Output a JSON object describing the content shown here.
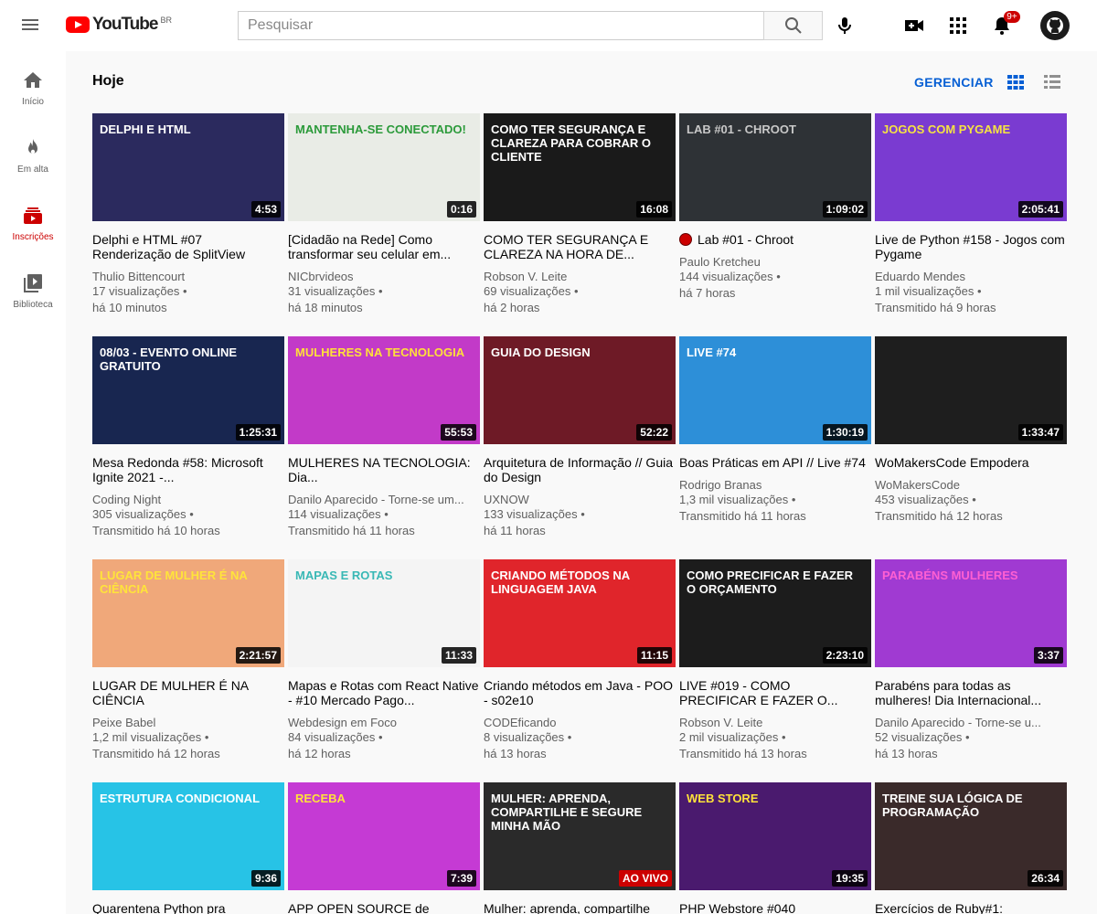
{
  "header": {
    "logo_text": "YouTube",
    "country": "BR",
    "search_placeholder": "Pesquisar",
    "notifications_badge": "9+"
  },
  "sidebar": {
    "items": [
      {
        "label": "Início",
        "icon": "home-icon"
      },
      {
        "label": "Em alta",
        "icon": "fire-icon"
      },
      {
        "label": "Inscrições",
        "icon": "subscriptions-icon",
        "active": true
      },
      {
        "label": "Biblioteca",
        "icon": "library-icon"
      }
    ]
  },
  "section": {
    "title": "Hoje",
    "manage_label": "GERENCIAR"
  },
  "videos": [
    {
      "title": "Delphi e HTML #07 Renderização de SplitView",
      "channel": "Thulio Bittencourt",
      "views": "17 visualizações",
      "time": "há 10 minutos",
      "duration": "4:53",
      "thumb_text": "Delphi e HTML",
      "thumb_bg": "#2b2a5e",
      "thumb_fg": "#ffffff"
    },
    {
      "title": "[Cidadão na Rede] Como transformar seu celular em...",
      "channel": "NICbrvideos",
      "views": "31 visualizações",
      "time": "há 18 minutos",
      "duration": "0:16",
      "thumb_text": "Mantenha-se conectado!",
      "thumb_bg": "#e9ece6",
      "thumb_fg": "#2b9a3a"
    },
    {
      "title": "COMO TER SEGURANÇA E CLAREZA NA HORA DE...",
      "channel": "Robson V. Leite",
      "views": "69 visualizações",
      "time": "há 2 horas",
      "duration": "16:08",
      "thumb_text": "Como ter segurança e clareza para cobrar o cliente",
      "thumb_bg": "#1a1a1a",
      "thumb_fg": "#ffffff"
    },
    {
      "title": "Lab #01 - Chroot",
      "channel": "Paulo Kretcheu",
      "views": "144 visualizações",
      "time": "há 7 horas",
      "duration": "1:09:02",
      "live_dot": true,
      "thumb_text": "Lab #01 - chroot",
      "thumb_bg": "#2e3236",
      "thumb_fg": "#c8c8c8"
    },
    {
      "title": "Live de Python #158 - Jogos com Pygame",
      "channel": "Eduardo Mendes",
      "views": "1 mil visualizações",
      "time": "Transmitido há 9 horas",
      "duration": "2:05:41",
      "thumb_text": "Jogos com Pygame",
      "thumb_bg": "#7a3bd1",
      "thumb_fg": "#f5e342"
    },
    {
      "title": "Mesa Redonda #58: Microsoft Ignite 2021 -...",
      "channel": "Coding Night",
      "views": "305 visualizações",
      "time": "Transmitido há 10 horas",
      "duration": "1:25:31",
      "thumb_text": "08/03 - Evento online gratuito",
      "thumb_bg": "#182650",
      "thumb_fg": "#ffffff"
    },
    {
      "title": "MULHERES NA TECNOLOGIA: Dia...",
      "channel": "Danilo Aparecido - Torne-se um...",
      "views": "114 visualizações",
      "time": "Transmitido há 11 horas",
      "duration": "55:53",
      "thumb_text": "Mulheres na tecnologia",
      "thumb_bg": "#c23ac8",
      "thumb_fg": "#ffe03a"
    },
    {
      "title": "Arquitetura de Informação // Guia do Design",
      "channel": "UXNOW",
      "views": "133 visualizações",
      "time": "há 11 horas",
      "duration": "52:22",
      "thumb_text": "Guia do Design",
      "thumb_bg": "#6e1a26",
      "thumb_fg": "#ffffff"
    },
    {
      "title": "Boas Práticas em API // Live #74",
      "channel": "Rodrigo Branas",
      "views": "1,3 mil visualizações",
      "time": "Transmitido há 11 horas",
      "duration": "1:30:19",
      "thumb_text": "Live #74",
      "thumb_bg": "#2d8fd8",
      "thumb_fg": "#ffffff"
    },
    {
      "title": "WoMakersCode Empodera",
      "channel": "WoMakersCode",
      "views": "453 visualizações",
      "time": "Transmitido há 12 horas",
      "duration": "1:33:47",
      "thumb_text": "",
      "thumb_bg": "#1e1e1e",
      "thumb_fg": "#ffffff"
    },
    {
      "title": "LUGAR DE MULHER É NA CIÊNCIA",
      "channel": "Peixe Babel",
      "views": "1,2 mil visualizações",
      "time": "Transmitido há 12 horas",
      "duration": "2:21:57",
      "thumb_text": "Lugar de mulher é na ciência",
      "thumb_bg": "#f0a87a",
      "thumb_fg": "#ffe43a"
    },
    {
      "title": "Mapas e Rotas com React Native - #10 Mercado Pago...",
      "channel": "Webdesign em Foco",
      "views": "84 visualizações",
      "time": "há 12 horas",
      "duration": "11:33",
      "thumb_text": "Mapas e Rotas",
      "thumb_bg": "#f4f4f4",
      "thumb_fg": "#39b8b5"
    },
    {
      "title": "Criando métodos em Java - POO - s02e10",
      "channel": "CODEficando",
      "views": "8 visualizações",
      "time": "há 13 horas",
      "duration": "11:15",
      "thumb_text": "Criando métodos na linguagem Java",
      "thumb_bg": "#e0252b",
      "thumb_fg": "#ffffff"
    },
    {
      "title": "LIVE #019 - COMO PRECIFICAR E FAZER O...",
      "channel": "Robson V. Leite",
      "views": "2 mil visualizações",
      "time": "Transmitido há 13 horas",
      "duration": "2:23:10",
      "thumb_text": "Como precificar e fazer o orçamento",
      "thumb_bg": "#1c1c1c",
      "thumb_fg": "#ffffff"
    },
    {
      "title": "Parabéns para todas as mulheres! Dia Internacional...",
      "channel": "Danilo Aparecido - Torne-se u...",
      "views": "52 visualizações",
      "time": "há 13 horas",
      "duration": "3:37",
      "thumb_text": "Parabéns Mulheres",
      "thumb_bg": "#a03ad2",
      "thumb_fg": "#ff5fd3"
    },
    {
      "title": "Quarentena Python pra",
      "channel": "",
      "views": "",
      "time": "",
      "duration": "9:36",
      "thumb_text": "Estrutura condicional",
      "thumb_bg": "#27c3e6",
      "thumb_fg": "#ffffff"
    },
    {
      "title": "APP OPEN SOURCE de",
      "channel": "",
      "views": "",
      "time": "",
      "duration": "7:39",
      "thumb_text": "Receba",
      "thumb_bg": "#c53ad4",
      "thumb_fg": "#ffe23a"
    },
    {
      "title": "Mulher: aprenda, compartilhe",
      "channel": "",
      "views": "",
      "time": "",
      "duration": "AO VIVO",
      "thumb_text": "Mulher: aprenda, compartilhe e segure minha mão",
      "thumb_bg": "#2a2a2a",
      "thumb_fg": "#ffffff"
    },
    {
      "title": "PHP Webstore #040",
      "channel": "",
      "views": "",
      "time": "",
      "duration": "19:35",
      "thumb_text": "Web Store",
      "thumb_bg": "#4a1a6e",
      "thumb_fg": "#ffe23a"
    },
    {
      "title": "Exercícios de Ruby#1:",
      "channel": "",
      "views": "",
      "time": "",
      "duration": "26:34",
      "thumb_text": "Treine sua lógica de programação",
      "thumb_bg": "#3a2a2a",
      "thumb_fg": "#ffffff"
    }
  ]
}
